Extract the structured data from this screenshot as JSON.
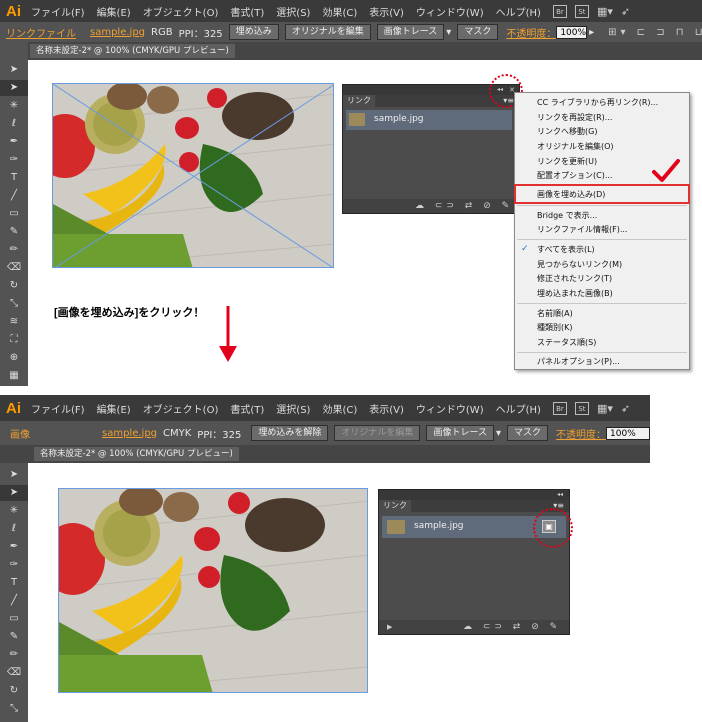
{
  "top": {
    "app_logo": "Ai",
    "menu": [
      "ファイル(F)",
      "編集(E)",
      "オブジェクト(O)",
      "書式(T)",
      "選択(S)",
      "効果(C)",
      "表示(V)",
      "ウィンドウ(W)",
      "ヘルプ(H)"
    ],
    "bridge_icons": [
      "Br",
      "St"
    ],
    "control": {
      "label": "リンクファイル",
      "filename": "sample.jpg",
      "color_mode": "RGB",
      "ppi": "PPI：325",
      "embed_button": "埋め込み",
      "edit_original_button": "オリジナルを編集",
      "image_trace_button": "画像トレース",
      "mask_button": "マスク",
      "opacity_label": "不透明度：",
      "opacity_value": "100%"
    },
    "doc_tab": "名称未設定-2* @ 100% (CMYK/GPU プレビュー)",
    "links_panel": {
      "tab": "リンク",
      "item_name": "sample.jpg",
      "collapse_icon": "◂◂",
      "close_icon": "✕"
    },
    "context_menu": {
      "items": [
        {
          "label": "CC ライブラリから再リンク(R)...",
          "checked": false,
          "highlight": false
        },
        {
          "label": "リンクを再設定(R)...",
          "checked": false,
          "highlight": false
        },
        {
          "label": "リンクへ移動(G)",
          "checked": false,
          "highlight": false
        },
        {
          "label": "オリジナルを編集(O)",
          "checked": false,
          "highlight": false
        },
        {
          "label": "リンクを更新(U)",
          "checked": false,
          "highlight": false
        },
        {
          "label": "配置オプション(C)...",
          "checked": false,
          "highlight": false
        },
        {
          "label": "画像を埋め込み(D)",
          "checked": false,
          "highlight": true
        },
        {
          "label": "Bridge で表示...",
          "checked": false,
          "highlight": false
        },
        {
          "label": "リンクファイル情報(F)...",
          "checked": false,
          "highlight": false
        },
        {
          "label": "すべてを表示(L)",
          "checked": true,
          "highlight": false
        },
        {
          "label": "見つからないリンク(M)",
          "checked": false,
          "highlight": false
        },
        {
          "label": "修正されたリンク(T)",
          "checked": false,
          "highlight": false
        },
        {
          "label": "埋め込まれた画像(B)",
          "checked": false,
          "highlight": false
        },
        {
          "label": "名前順(A)",
          "checked": false,
          "highlight": false
        },
        {
          "label": "種類別(K)",
          "checked": false,
          "highlight": false
        },
        {
          "label": "ステータス順(S)",
          "checked": false,
          "highlight": false
        },
        {
          "label": "パネルオプション(P)...",
          "checked": false,
          "highlight": false
        }
      ]
    }
  },
  "instruction": "[画像を埋め込み]をクリック！",
  "bottom": {
    "app_logo": "Ai",
    "menu": [
      "ファイル(F)",
      "編集(E)",
      "オブジェクト(O)",
      "書式(T)",
      "選択(S)",
      "効果(C)",
      "表示(V)",
      "ウィンドウ(W)",
      "ヘルプ(H)"
    ],
    "bridge_icons": [
      "Br",
      "St"
    ],
    "control": {
      "label": "画像",
      "filename": "sample.jpg",
      "color_mode": "CMYK",
      "ppi": "PPI：325",
      "unembed_button": "埋め込みを解除",
      "edit_original_button": "オリジナルを編集",
      "image_trace_button": "画像トレース",
      "mask_button": "マスク",
      "opacity_label": "不透明度：",
      "opacity_value": "100%"
    },
    "doc_tab": "名称未設定-2* @ 100% (CMYK/GPU プレビュー)",
    "links_panel": {
      "tab": "リンク",
      "item_name": "sample.jpg",
      "collapse_icon": "◂◂"
    }
  },
  "colors": {
    "accent_red": "#e3001b",
    "ui_orange": "#f0a030",
    "highlight_box": "#e03030",
    "selection_blue": "#6a9be0"
  }
}
